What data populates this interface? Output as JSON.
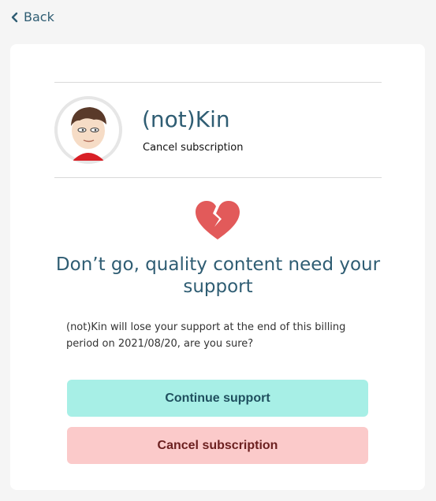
{
  "nav": {
    "back_label": "Back",
    "back_icon": "chevron-left-icon"
  },
  "creator": {
    "name": "(not)Kin",
    "subtitle": "Cancel subscription",
    "avatar_icon": "avatar-cartoon"
  },
  "message": {
    "icon": "broken-heart-icon",
    "headline": "Don’t go, quality content need your support",
    "body": "(not)Kin will lose your support at the end of this billing period on 2021/08/20, are you sure?"
  },
  "actions": {
    "continue_label": "Continue support",
    "cancel_label": "Cancel subscription"
  },
  "colors": {
    "accent": "#2f5d73",
    "heart": "#e25a5a",
    "continue_bg": "#a7efe6",
    "cancel_bg": "#fbcaca"
  }
}
